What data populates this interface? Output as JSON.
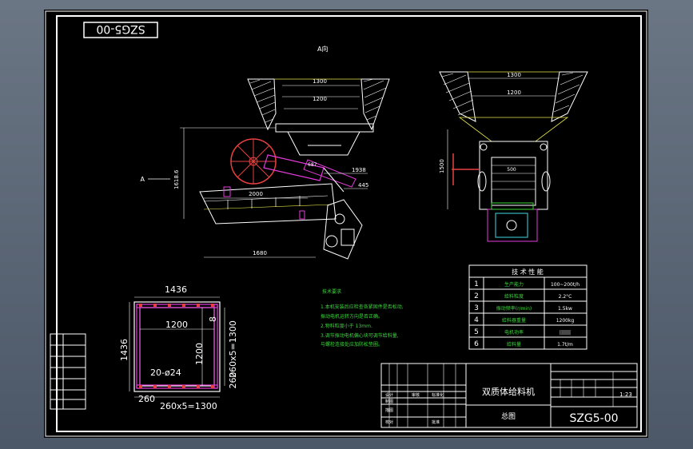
{
  "drawing": {
    "title_box": "SZG5-00",
    "view_label_top": "A向",
    "view_arrow_label": "A"
  },
  "side_view": {
    "dims": [
      "1300",
      "1200",
      "1618.6",
      "1938",
      "445",
      "2000",
      "1680",
      "687"
    ]
  },
  "front_view": {
    "dims": [
      "1300",
      "1200",
      "1500",
      "500"
    ]
  },
  "plan_view": {
    "dims": [
      "1436",
      "1200",
      "1200",
      "1436",
      "260x5=1300",
      "20-ø24",
      "260",
      "260x5=1300",
      "260"
    ]
  },
  "notes": {
    "heading": "技术要求",
    "lines": [
      "1.本机安装后应检查各紧固件是否松动,",
      "  振动电机运转方向是否正确。",
      "2.物料粒度小于 13mm.",
      "3.调节振动电机偏心块可调节给料量,",
      "  与螺栓连接处应加防松垫圈。"
    ]
  },
  "spec_table": {
    "header": "技 术 性 能",
    "rows": [
      {
        "no": "1",
        "name": "生产能力",
        "value": "100~200t/h"
      },
      {
        "no": "2",
        "name": "给料粒度",
        "value": "2.2°C"
      },
      {
        "no": "3",
        "name": "振动频率(r/min)",
        "value": "1.5kw"
      },
      {
        "no": "4",
        "name": "给料器重量",
        "value": "1200kg"
      },
      {
        "no": "5",
        "name": "电机功率",
        "value": "|||||||"
      },
      {
        "no": "6",
        "name": "给料量",
        "value": "1.7t/m"
      }
    ]
  },
  "title_block": {
    "machine_name": "双质体给料机",
    "drawing_type": "总图",
    "drawing_no": "SZG5-00",
    "scale": "1:23",
    "left_cells": [
      "设计",
      "制图",
      "描图",
      "校对",
      "审核",
      "标准化",
      "批准"
    ]
  }
}
